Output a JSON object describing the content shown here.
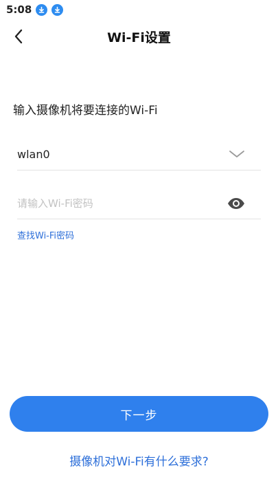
{
  "status_bar": {
    "time": "5:08",
    "icons": [
      "download-icon",
      "download-icon"
    ]
  },
  "header": {
    "back_icon": "chevron-left-icon",
    "title": "Wi-Fi设置"
  },
  "form": {
    "instruction": "输入摄像机将要连接的Wi-Fi",
    "ssid": {
      "value": "wlan0",
      "dropdown_icon": "chevron-down-icon"
    },
    "password": {
      "value": "",
      "placeholder": "请输入Wi-Fi密码",
      "toggle_icon": "eye-icon"
    },
    "find_password_link": "查找Wi-Fi密码"
  },
  "actions": {
    "next_label": "下一步",
    "requirements_link": "摄像机对Wi-Fi有什么要求?"
  },
  "colors": {
    "accent": "#2f80ed",
    "link": "#2d6fd9",
    "download_badge": "#2d8cf0"
  }
}
